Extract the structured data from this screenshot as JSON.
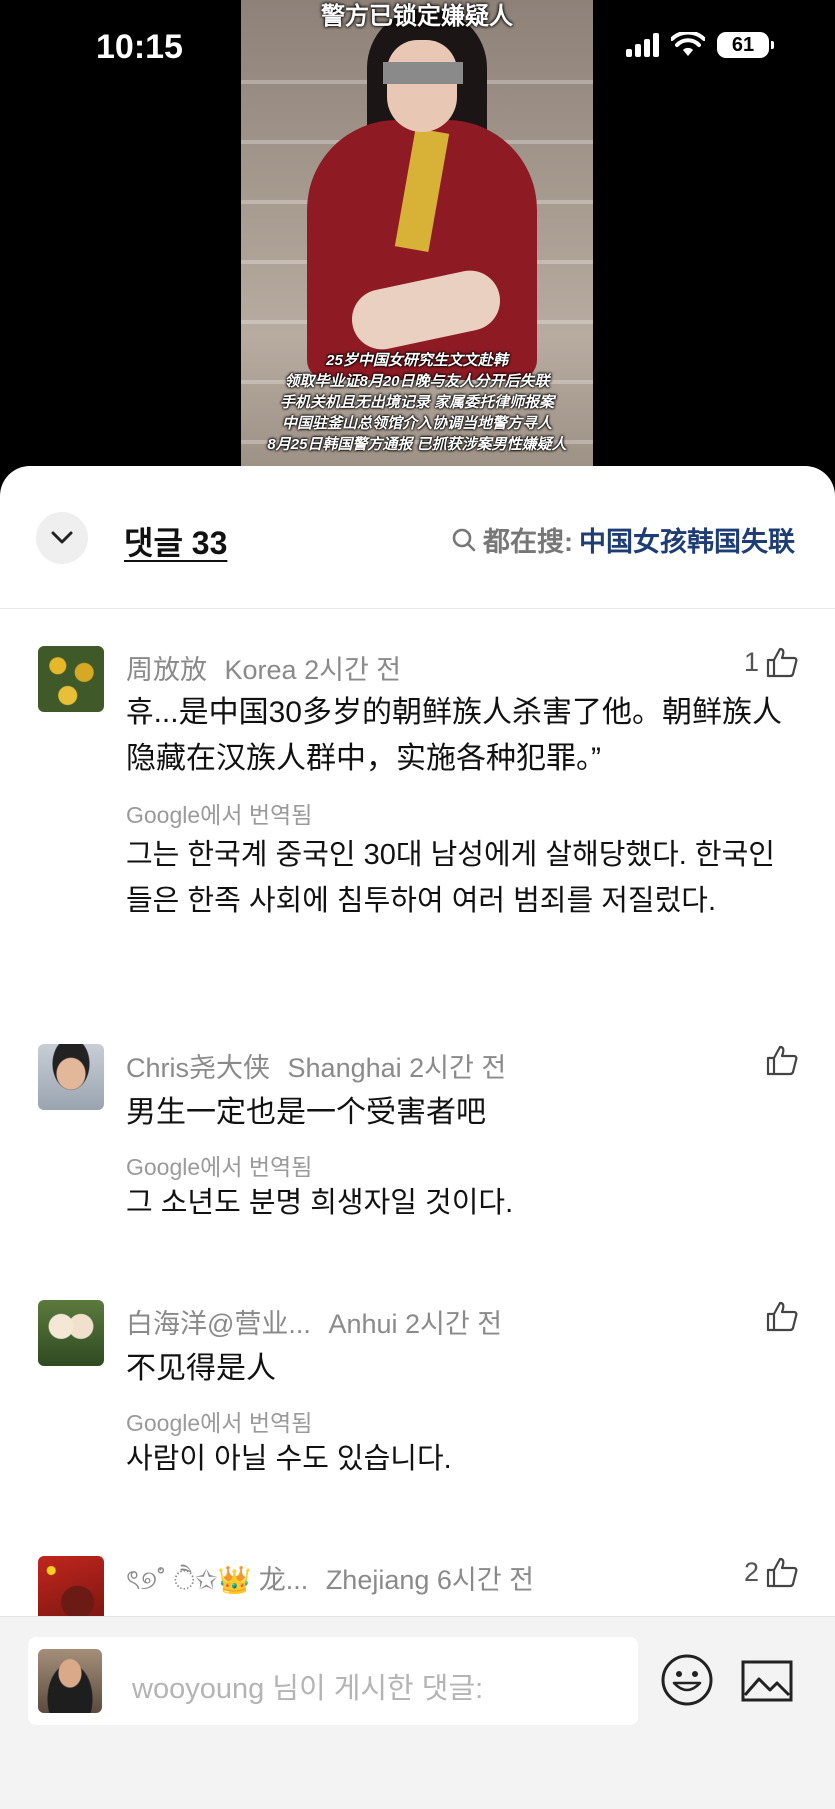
{
  "status_bar": {
    "time": "10:15",
    "battery": "61"
  },
  "video": {
    "title": "警方已锁定嫌疑人",
    "caption_lines": [
      "25岁中国女研究生文文赴韩",
      "领取毕业证8月20日晚与友人分开后失联",
      "手机关机且无出境记录 家属委托律师报案",
      "中国驻釜山总领馆介入协调当地警方寻人",
      "8月25日韩国警方通报 已抓获涉案男性嫌疑人"
    ]
  },
  "header": {
    "comment_count": "댓글 33",
    "search_label": "都在搜:",
    "search_term": "中国女孩韩国失联"
  },
  "comments": [
    {
      "user": "周放放",
      "location": "Korea",
      "time": "2시간 전",
      "likes": "1",
      "text": "휴...是中国30多岁的朝鲜族人杀害了他。朝鲜族人隐藏在汉族人群中，实施各种犯罪。”",
      "translated_label": "Google에서 번역됨",
      "translation": "그는 한국계 중국인 30대 남성에게 살해당했다. 한국인들은 한족 사회에 침투하여 여러 범죄를 저질렀다."
    },
    {
      "user": "Chris尧大侠",
      "location": "Shanghai",
      "time": "2시간 전",
      "likes": "",
      "text": "男生一定也是一个受害者吧",
      "translated_label": "Google에서 번역됨",
      "translation": "그 소년도 분명 희생자일 것이다."
    },
    {
      "user": "白海洋@营业...",
      "location": "Anhui",
      "time": "2시간 전",
      "likes": "",
      "text": "不见得是人",
      "translated_label": "Google에서 번역됨",
      "translation": "사람이 아닐 수도 있습니다."
    },
    {
      "user": "ৎ୭࣪˚ ੈ✩👑 龙...",
      "location": "Zhejiang",
      "time": "6시간 전",
      "likes": "2",
      "text": "",
      "translated_label": "",
      "translation": ""
    }
  ],
  "input": {
    "placeholder": "wooyoung 님이 게시한 댓글:"
  },
  "icons": {
    "collapse": "chevron-down-icon",
    "search": "search-icon",
    "like": "thumbs-up-icon",
    "emoji": "smiley-icon",
    "image": "image-icon"
  },
  "colors": {
    "search_term": "#1d3d74",
    "meta_gray": "#8a8a8a"
  }
}
